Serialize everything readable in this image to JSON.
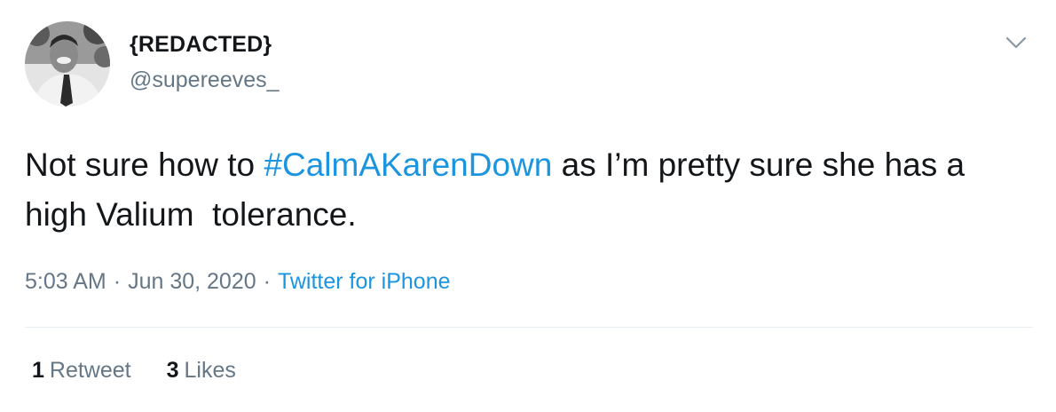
{
  "author": {
    "display_name": "{REDACTED}",
    "handle": "@supereeves_",
    "avatar": "avatar-photo"
  },
  "menu": {
    "icon": "chevron-down-icon"
  },
  "tweet": {
    "text_before": "Not sure how to ",
    "hashtag": "#CalmAKarenDown",
    "text_after": " as I’m pretty sure she has a high Valium  tolerance."
  },
  "meta": {
    "time": "5:03 AM",
    "separator": "·",
    "date": "Jun 30, 2020",
    "source": "Twitter for iPhone"
  },
  "stats": {
    "retweets_count": "1",
    "retweets_label": "Retweet",
    "likes_count": "3",
    "likes_label": "Likes"
  },
  "colors": {
    "text": "#14171a",
    "secondary": "#657786",
    "link": "#1b95e0",
    "divider": "#e6ecf0"
  }
}
